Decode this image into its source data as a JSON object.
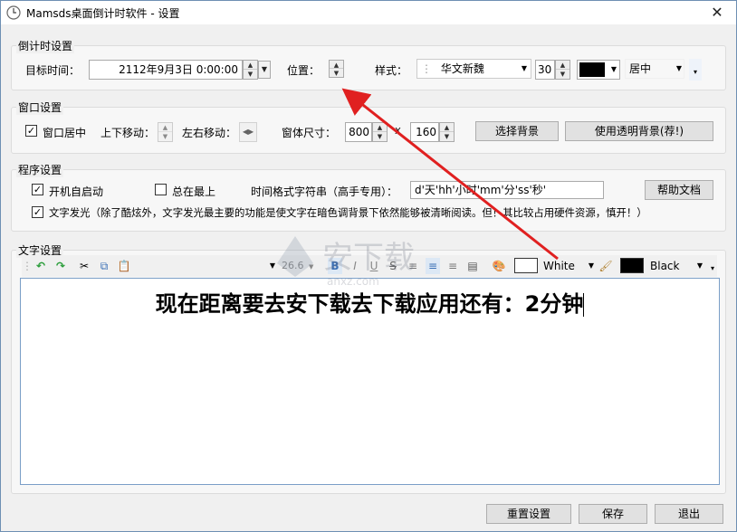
{
  "window": {
    "title": "Mamsds桌面倒计时软件 - 设置",
    "close_glyph": "✕"
  },
  "countdown_settings": {
    "legend": "倒计时设置",
    "target_time_label": "目标时间：",
    "target_time_value": "2112年9月3日 0:00:00",
    "position_label": "位置：",
    "style_label": "样式：",
    "font_name": "华文新魏",
    "font_size": "30",
    "align": "居中"
  },
  "window_settings": {
    "legend": "窗口设置",
    "center_label": "窗口居中",
    "center_checked": true,
    "move_vertical_label": "上下移动：",
    "move_horizontal_label": "左右移动：",
    "size_label": "窗体尺寸：",
    "width": "800",
    "times": "X",
    "height": "160",
    "choose_bg_button": "选择背景",
    "transparent_bg_button": "使用透明背景(荐!)"
  },
  "program_settings": {
    "legend": "程序设置",
    "autostart_label": "开机自启动",
    "autostart_checked": true,
    "topmost_label": "总在最上",
    "topmost_checked": false,
    "format_label": "时间格式字符串（高手专用）：",
    "format_value": "d'天'hh'小时'mm'分'ss'秒'",
    "help_button": "帮助文档",
    "glow_label": "文字发光（除了酷炫外，文字发光最主要的功能是使文字在暗色调背景下依然能够被清晰阅读。但！其比较占用硬件资源，慎开！）",
    "glow_checked": true
  },
  "text_settings": {
    "legend": "文字设置",
    "font_size_value": "26.6",
    "fore_color_name": "White",
    "back_color_name": "Black",
    "fore_color": "#ffffff",
    "back_color": "#000000",
    "editor_text": "现在距离要去安下载去下载应用还有：2分钟"
  },
  "footer": {
    "reset_button": "重置设置",
    "save_button": "保存",
    "exit_button": "退出"
  },
  "watermark": {
    "text": "安下载",
    "subtext": "anxz.com"
  },
  "colors": {
    "arrow": "#e02020",
    "editor_border": "#7a9ec7"
  }
}
